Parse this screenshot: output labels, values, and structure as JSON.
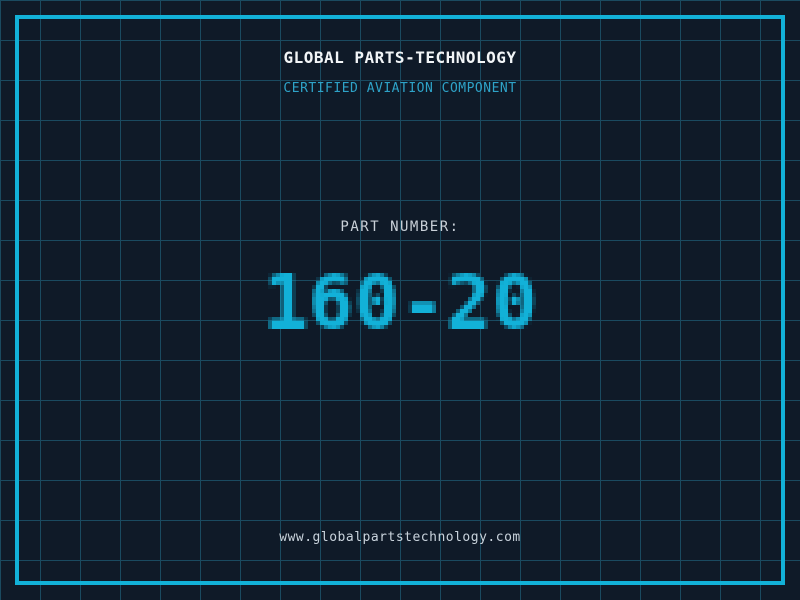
{
  "colors": {
    "background": "#0f1a28",
    "grid_line": "#1a4a60",
    "accent_cyan": "#12b1d8",
    "title_white": "#f2f5f7",
    "tagline_cyan": "#2ea3c8",
    "label_gray": "#c9d0d8",
    "url_gray": "#c9d3dc"
  },
  "header": {
    "company_name": "GLOBAL PARTS-TECHNOLOGY",
    "tagline": "CERTIFIED AVIATION COMPONENT"
  },
  "part": {
    "label": "PART NUMBER:",
    "number": "160-20"
  },
  "footer": {
    "website": "www.globalpartstechnology.com"
  }
}
